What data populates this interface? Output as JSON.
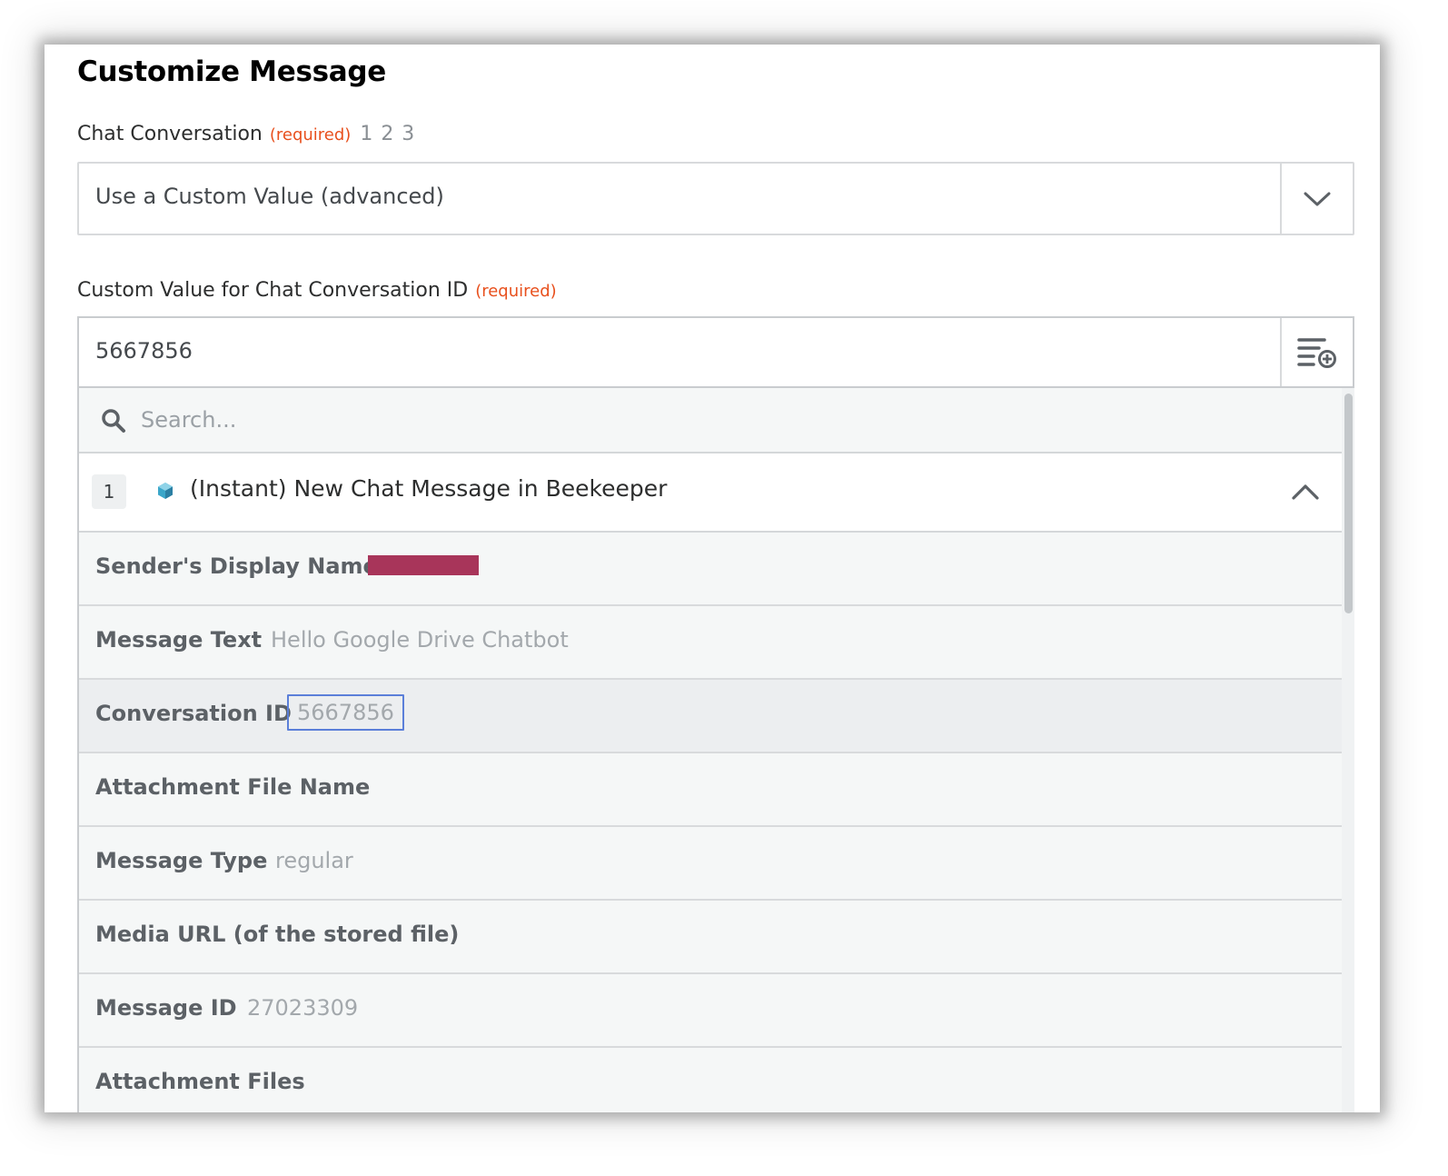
{
  "panel": {
    "title": "Customize Message"
  },
  "chat_conversation": {
    "label": "Chat Conversation",
    "required": "(required)",
    "steps": "1 2 3",
    "selected_value": "Use a Custom Value (advanced)",
    "icon": "chevron-down-icon"
  },
  "custom_value": {
    "label": "Custom Value for Chat Conversation ID",
    "required": "(required)",
    "value": "5667856",
    "icon": "insert-data-icon"
  },
  "dropdown": {
    "search_placeholder": "Search...",
    "step": {
      "number": "1",
      "title": "(Instant) New Chat Message in Beekeeper",
      "app_icon": "beekeeper-app-icon",
      "collapse_icon": "chevron-up-icon"
    },
    "fields": [
      {
        "name": "Sender's Display Name",
        "value": "",
        "redacted": true
      },
      {
        "name": "Message Text",
        "value": "Hello Google Drive Chatbot"
      },
      {
        "name": "Conversation ID",
        "value": "5667856",
        "selected": true
      },
      {
        "name": "Attachment File Name",
        "value": ""
      },
      {
        "name": "Message Type",
        "value": "regular"
      },
      {
        "name": "Media URL (of the stored file)",
        "value": ""
      },
      {
        "name": "Message ID",
        "value": "27023309"
      },
      {
        "name": "Attachment Files",
        "value": ""
      }
    ]
  },
  "colors": {
    "required": "#e8501d",
    "redaction": "#a8355a",
    "selected_outline": "#5b7fd9",
    "app_icon": "#3aa6c9"
  }
}
